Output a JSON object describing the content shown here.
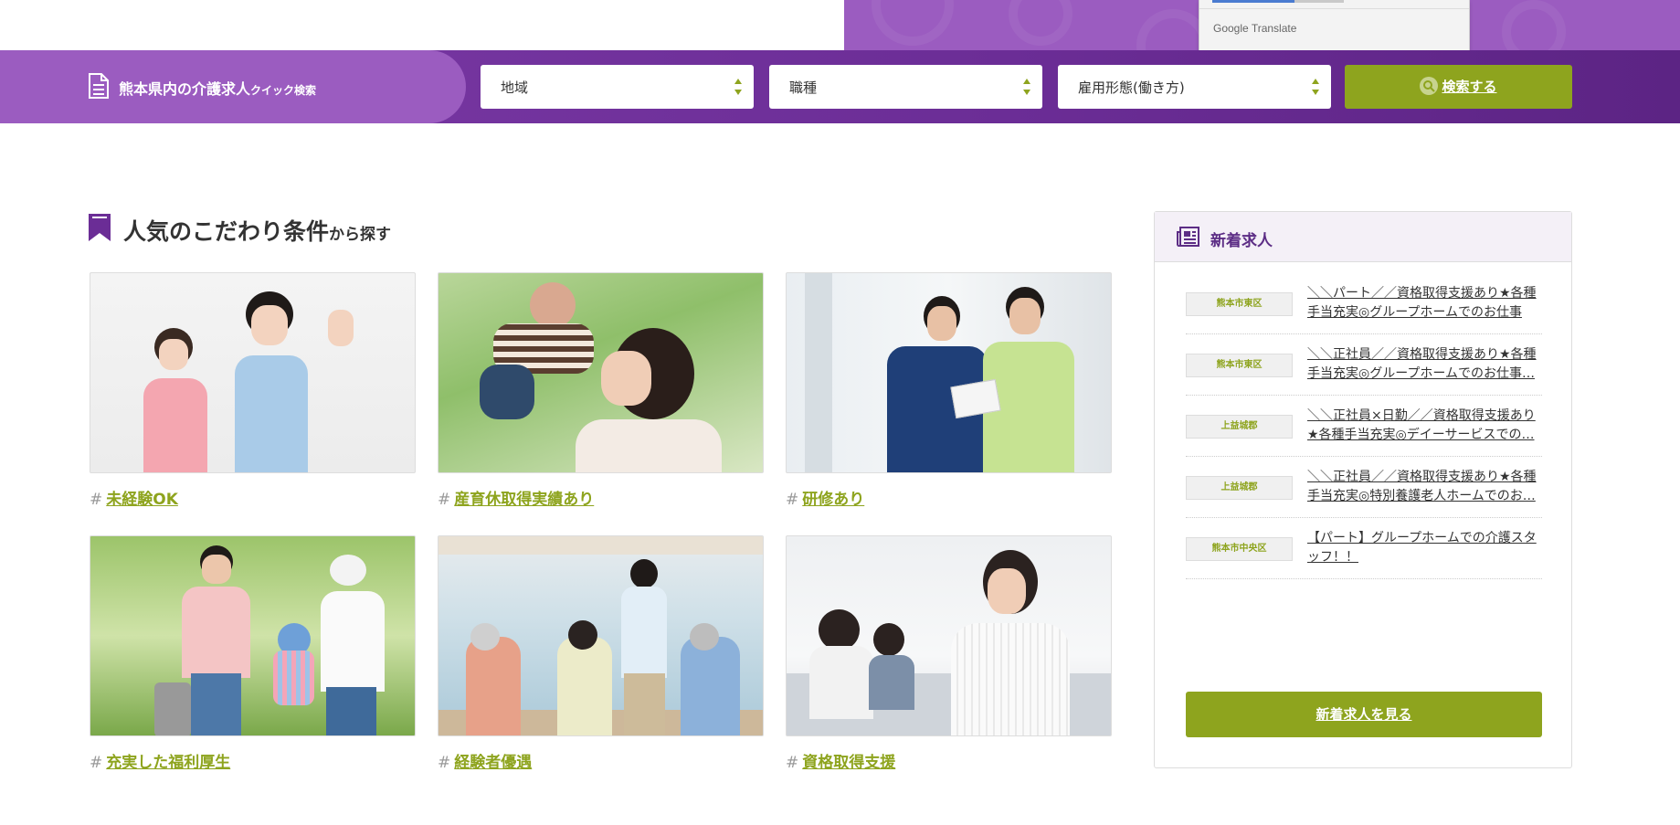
{
  "translate_popup": {
    "label": "Google Translate"
  },
  "search_bar": {
    "title_main": "熊本県内の介護求人",
    "title_small": "クイック検索",
    "selects": [
      {
        "value": "地域"
      },
      {
        "value": "職種"
      },
      {
        "value": "雇用形態(働き方)"
      }
    ],
    "button_label": "検索する"
  },
  "section": {
    "title_main": "人気のこだわり条件",
    "title_small": "から探す"
  },
  "categories": [
    {
      "hash": "#",
      "label": "未経験OK"
    },
    {
      "hash": "#",
      "label": "産育休取得実績あり"
    },
    {
      "hash": "#",
      "label": "研修あり"
    },
    {
      "hash": "#",
      "label": "充実した福利厚生"
    },
    {
      "hash": "#",
      "label": "経験者優遇"
    },
    {
      "hash": "#",
      "label": "資格取得支援"
    }
  ],
  "new_jobs": {
    "title": "新着求人",
    "items": [
      {
        "area": "熊本市東区",
        "title": "＼＼パート／／資格取得支援あり★各種手当充実◎グループホームでのお仕事で…"
      },
      {
        "area": "熊本市東区",
        "title": "＼＼正社員／／資格取得支援あり★各種手当充実◎グループホームでのお仕事…"
      },
      {
        "area": "上益城郡",
        "title": "＼＼正社員×日勤／／資格取得支援あり★各種手当充実◎デイーサービスでの…"
      },
      {
        "area": "上益城郡",
        "title": "＼＼正社員／／資格取得支援あり★各種手当充実◎特別養護老人ホームでのお…"
      },
      {
        "area": "熊本市中央区",
        "title": "【パート】グループホームでの介護スタッフ！！"
      }
    ],
    "button_label": "新着求人を見る"
  },
  "colors": {
    "purple_light": "#9b5cc0",
    "purple_dark": "#6b2d96",
    "accent_green": "#8ea41e"
  }
}
